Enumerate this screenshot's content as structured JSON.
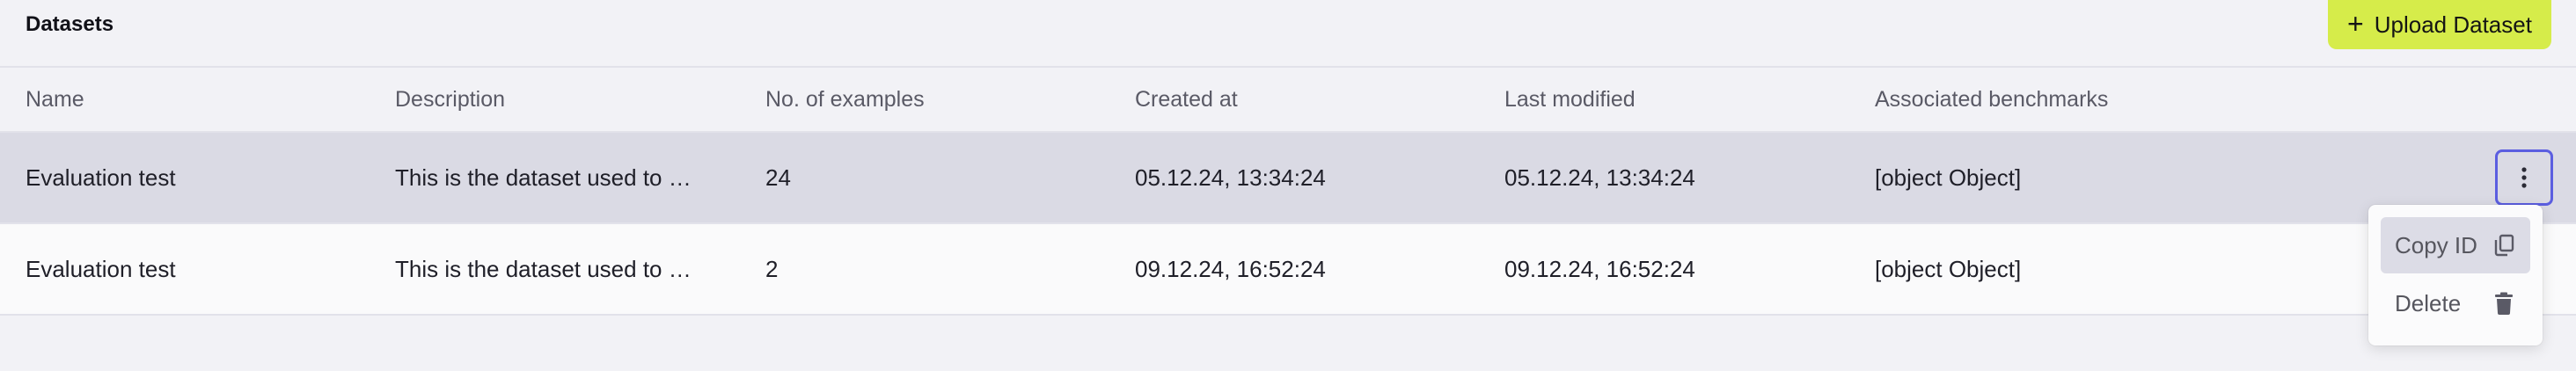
{
  "header": {
    "title": "Datasets",
    "upload_label": "Upload Dataset",
    "upload_icon": "plus-icon",
    "accent_color": "#d6ec4a"
  },
  "table": {
    "columns": [
      "Name",
      "Description",
      "No. of examples",
      "Created at",
      "Last modified",
      "Associated benchmarks"
    ],
    "rows": [
      {
        "name": "Evaluation test",
        "description": "This is the dataset used to t…",
        "examples": "24",
        "created": "05.12.24, 13:34:24",
        "modified": "05.12.24, 13:34:24",
        "benchmarks": "[object Object]",
        "selected": true
      },
      {
        "name": "Evaluation test",
        "description": "This is the dataset used to t…",
        "examples": "2",
        "created": "09.12.24, 16:52:24",
        "modified": "09.12.24, 16:52:24",
        "benchmarks": "[object Object]",
        "selected": false
      }
    ]
  },
  "row_actions": {
    "trigger_icon": "more-vertical-icon",
    "focus_color": "#5b5ee0",
    "menu": [
      {
        "label": "Copy ID",
        "icon": "copy-icon"
      },
      {
        "label": "Delete",
        "icon": "trash-icon"
      }
    ]
  }
}
